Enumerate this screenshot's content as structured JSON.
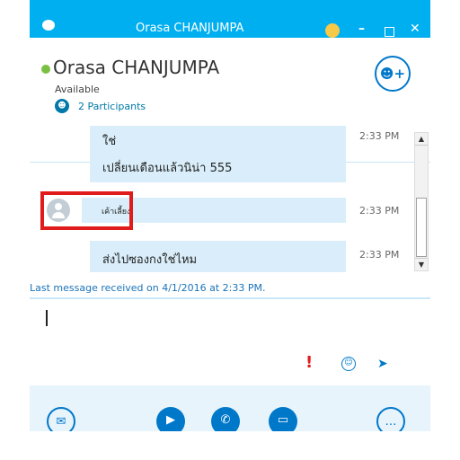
{
  "window": {
    "title": "Orasa CHANJUMPA"
  },
  "header": {
    "contact_name": "Orasa CHANJUMPA",
    "status": "Available",
    "participants": "2 Participants"
  },
  "messages": [
    {
      "lines": [
        "ใช่",
        "เปลี่ยนเดือนแล้วนิน่า 555"
      ],
      "time": "2:33 PM"
    },
    {
      "text": "เค้าเลี้ยง",
      "time": "2:33 PM"
    },
    {
      "text": "ส่งไปซองกงใช่ไหม",
      "time": "2:33 PM"
    }
  ],
  "status_line": "Last message received on 4/1/2016 at 2:33 PM.",
  "colors": {
    "accent": "#00aff0",
    "brand_blue": "#0078ca",
    "bubble": "#d9eefa",
    "highlight": "#e11b1b",
    "available": "#7ac143"
  },
  "icons": {
    "urgent": "exclamation-icon",
    "emoji": "smiley-icon",
    "send": "send-icon",
    "chat": "chat-icon",
    "video": "video-icon",
    "call": "phone-icon",
    "share": "screen-share-icon",
    "more": "more-icon",
    "add_person": "add-person-icon"
  }
}
